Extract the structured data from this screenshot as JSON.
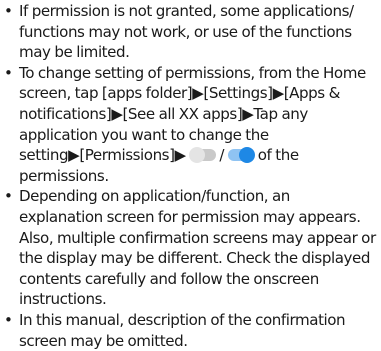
{
  "bullet_symbol": "•",
  "items": [
    {
      "text": "If permission is not granted, some applications/ functions may not work, or use of the functions may be limited."
    },
    {
      "text_before": "To change setting of permissions, from the Home screen, tap [apps folder]▶[Settings]▶[Apps & notifications]▶[See all XX apps]▶Tap any application you want to change the setting▶[Permissions]▶ ",
      "separator": " / ",
      "text_after": " of the permissions.",
      "toggle_off_icon": "toggle-off-icon",
      "toggle_on_icon": "toggle-on-icon",
      "toggle_on_color": "#1e88e5",
      "toggle_off_color": "#c9c9c9"
    },
    {
      "text": "Depending on application/function, an explanation screen for permission may appears. Also, multiple confirmation screens may appear or the display may be different. Check the displayed contents carefully and follow the onscreen instructions."
    },
    {
      "text": "In this manual, description of the confirmation screen may be omitted."
    }
  ]
}
